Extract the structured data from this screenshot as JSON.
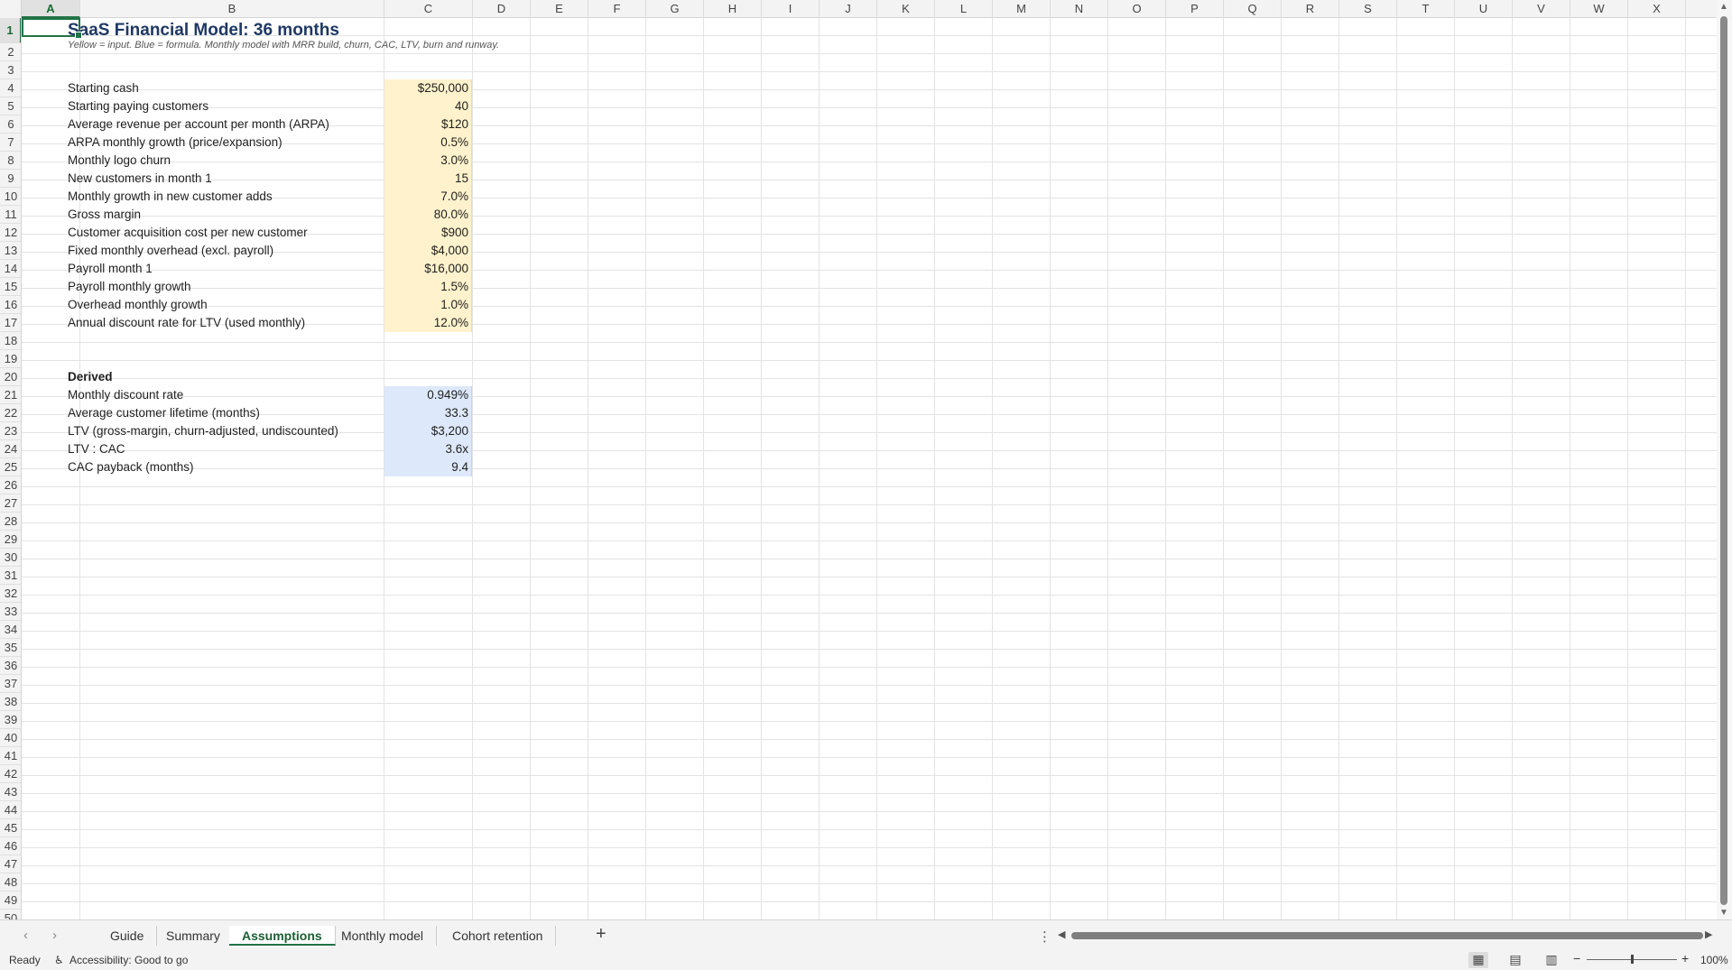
{
  "columns": [
    "A",
    "B",
    "C",
    "D",
    "E",
    "F",
    "G",
    "H",
    "I",
    "J",
    "K",
    "L",
    "M",
    "N",
    "O",
    "P",
    "Q",
    "R",
    "S",
    "T",
    "U",
    "V",
    "W",
    "X"
  ],
  "rows": [
    1,
    2,
    3,
    4,
    5,
    6,
    7,
    8,
    9,
    10,
    11,
    12,
    13,
    14,
    15,
    16,
    17,
    18,
    19,
    20,
    21,
    22,
    23,
    24,
    25,
    26,
    27,
    28,
    29,
    30,
    31,
    32,
    33,
    34,
    35,
    36,
    37,
    38,
    39,
    40,
    41,
    42,
    43,
    44,
    45,
    46,
    47,
    48,
    49,
    50
  ],
  "sheet": {
    "title": "SaaS Financial Model: 36 months",
    "subtitle": "Yellow = input. Blue = formula. Monthly model with MRR build, churn, CAC, LTV, burn and runway.",
    "inputs": [
      {
        "label": "Starting cash",
        "value": "$250,000"
      },
      {
        "label": "Starting paying customers",
        "value": "40"
      },
      {
        "label": "Average revenue per account per month (ARPA)",
        "value": "$120"
      },
      {
        "label": "ARPA monthly growth (price/expansion)",
        "value": "0.5%"
      },
      {
        "label": "Monthly logo churn",
        "value": "3.0%"
      },
      {
        "label": "New customers in month 1",
        "value": "15"
      },
      {
        "label": "Monthly growth in new customer adds",
        "value": "7.0%"
      },
      {
        "label": "Gross margin",
        "value": "80.0%"
      },
      {
        "label": "Customer acquisition cost per new customer",
        "value": "$900"
      },
      {
        "label": "Fixed monthly overhead (excl. payroll)",
        "value": "$4,000"
      },
      {
        "label": "Payroll month 1",
        "value": "$16,000"
      },
      {
        "label": "Payroll monthly growth",
        "value": "1.5%"
      },
      {
        "label": "Overhead monthly growth",
        "value": "1.0%"
      },
      {
        "label": "Annual discount rate for LTV (used monthly)",
        "value": "12.0%"
      }
    ],
    "derived_header": "Derived",
    "derived": [
      {
        "label": "Monthly discount rate",
        "value": "0.949%"
      },
      {
        "label": "Average customer lifetime (months)",
        "value": "33.3"
      },
      {
        "label": "LTV (gross-margin, churn-adjusted, undiscounted)",
        "value": "$3,200"
      },
      {
        "label": "LTV : CAC",
        "value": "3.6x"
      },
      {
        "label": "CAC payback (months)",
        "value": "9.4"
      }
    ]
  },
  "tabs": [
    "Guide",
    "Summary",
    "Assumptions",
    "Monthly model",
    "Cohort retention"
  ],
  "active_tab": "Assumptions",
  "status": {
    "ready": "Ready",
    "accessibility": "Accessibility: Good to go",
    "zoom": "100%"
  },
  "colors": {
    "input": "#fff2cc",
    "formula": "#dde8fa",
    "accent": "#217346",
    "title": "#1f3864"
  }
}
